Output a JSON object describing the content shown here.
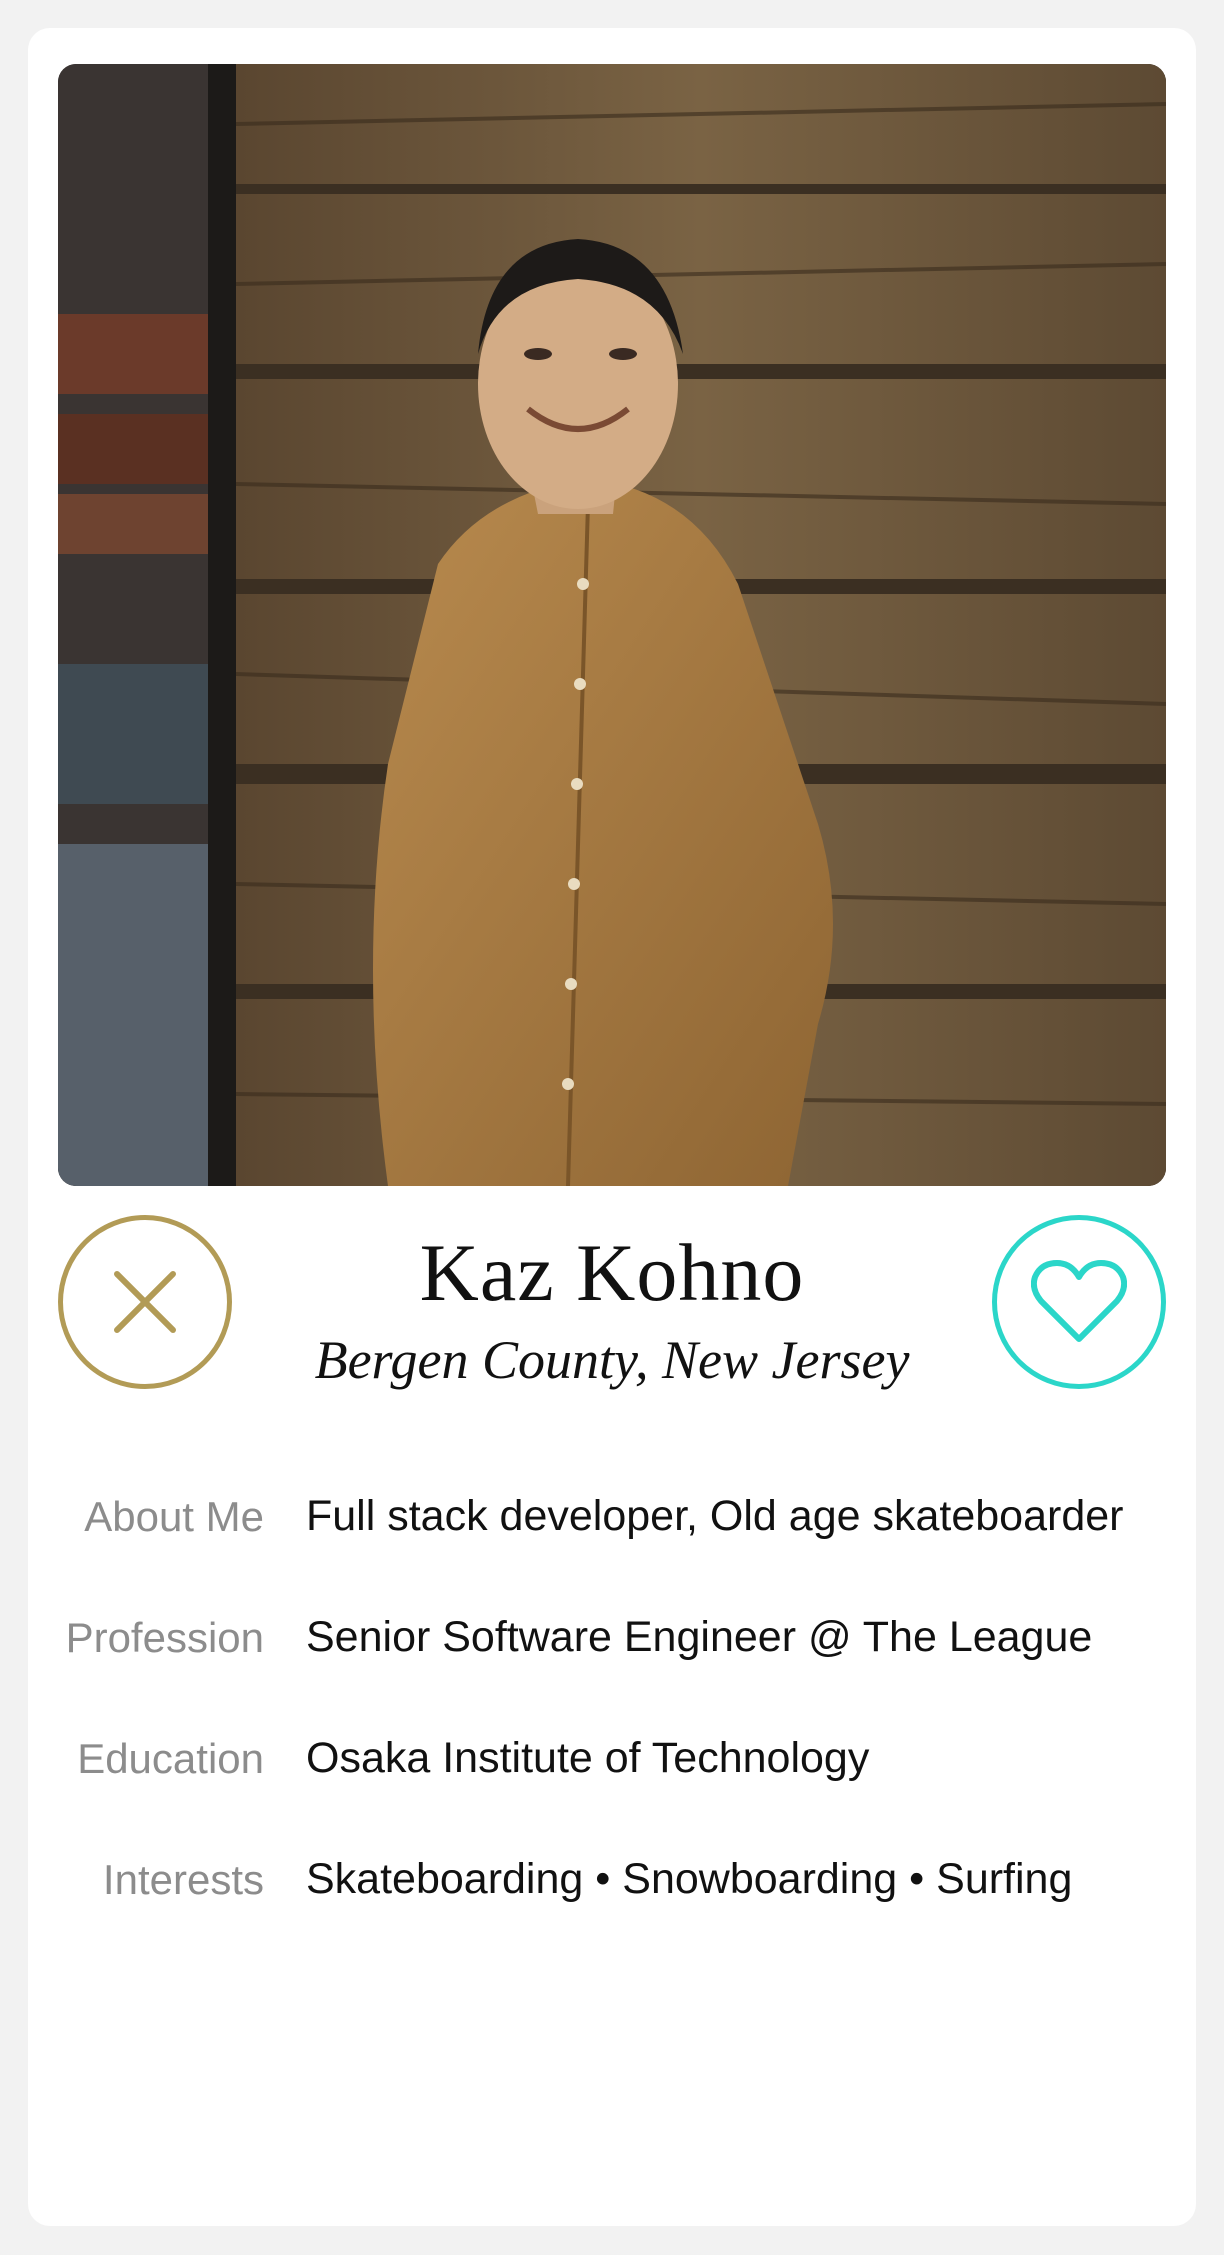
{
  "profile": {
    "name": "Kaz Kohno",
    "location": "Bergen County, New Jersey",
    "photo_alt": "Kaz Kohno"
  },
  "actions": {
    "pass_icon": "close-icon",
    "like_icon": "heart-icon",
    "pass_color": "#b29b56",
    "like_color": "#2bd6c9"
  },
  "details": [
    {
      "label": "About Me",
      "value": "Full stack developer, Old age skateboarder"
    },
    {
      "label": "Profession",
      "value": "Senior Software Engineer @ The League"
    },
    {
      "label": "Education",
      "value": "Osaka Institute of Technology"
    },
    {
      "label": "Interests",
      "value": "Skateboarding • Snowboarding • Surfing"
    }
  ]
}
